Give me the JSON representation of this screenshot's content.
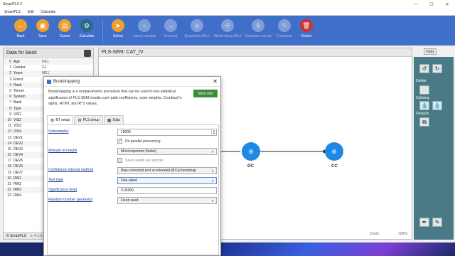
{
  "app": {
    "title": "SmartPLS 4",
    "menu": [
      "SmartPLS",
      "Edit",
      "Calculate"
    ],
    "window_controls": [
      "—",
      "☐",
      "✕"
    ]
  },
  "toolbar": {
    "items": [
      {
        "label": "Back",
        "icon": "back-arrow-icon",
        "color": "#f0a030",
        "glyph": "←",
        "dim": false
      },
      {
        "label": "Save",
        "icon": "save-icon",
        "color": "#f0a030",
        "glyph": "▣",
        "dim": false
      },
      {
        "label": "Comet",
        "icon": "document-icon",
        "color": "#f0a030",
        "glyph": "▤",
        "dim": false
      },
      {
        "label": "Calculate",
        "icon": "gear-icon",
        "color": "#2a6a8a",
        "glyph": "⚙",
        "dim": false
      },
      {
        "label": "Select",
        "icon": "cursor-icon",
        "color": "#f0a030",
        "glyph": "➤",
        "dim": false
      },
      {
        "label": "Latent variable",
        "icon": "latent-variable-icon",
        "color": "#f0a030",
        "glyph": "○",
        "dim": true
      },
      {
        "label": "Connect",
        "icon": "connect-icon",
        "color": "#f0a030",
        "glyph": "→",
        "dim": true
      },
      {
        "label": "Quadratic effect",
        "icon": "quadratic-icon",
        "color": "#f0a030",
        "glyph": "⊕",
        "dim": true
      },
      {
        "label": "Moderating effect",
        "icon": "moderating-icon",
        "color": "#f0a030",
        "glyph": "✣",
        "dim": true
      },
      {
        "label": "Gaussian copula",
        "icon": "copula-icon",
        "color": "#f0a030",
        "glyph": "✣",
        "dim": true
      },
      {
        "label": "Comment",
        "icon": "comment-icon",
        "color": "#f0a030",
        "glyph": "✎",
        "dim": true
      },
      {
        "label": "Delete",
        "icon": "trash-icon",
        "color": "#d03030",
        "glyph": "🗑",
        "dim": false
      }
    ]
  },
  "left_panel": {
    "title": "Data for Book",
    "rows": [
      {
        "n": "0",
        "name": "Age",
        "code": "NE1"
      },
      {
        "n": "1",
        "name": "Gender",
        "code": "G1"
      },
      {
        "n": "2",
        "name": "Years",
        "code": "ME1"
      },
      {
        "n": "3",
        "name": "Errect",
        "code": ""
      },
      {
        "n": "4",
        "name": "Rank",
        "code": ""
      },
      {
        "n": "5",
        "name": "Tenure",
        "code": ""
      },
      {
        "n": "6",
        "name": "System",
        "code": ""
      },
      {
        "n": "7",
        "name": "Bank",
        "code": ""
      },
      {
        "n": "8",
        "name": "Type",
        "code": ""
      },
      {
        "n": "9",
        "name": "VIS1",
        "code": ""
      },
      {
        "n": "10",
        "name": "VIS2",
        "code": ""
      },
      {
        "n": "11",
        "name": "VIS3",
        "code": ""
      },
      {
        "n": "12",
        "name": "VIS4",
        "code": ""
      },
      {
        "n": "13",
        "name": "DEV1",
        "code": ""
      },
      {
        "n": "14",
        "name": "DEV2",
        "code": ""
      },
      {
        "n": "15",
        "name": "DEV3",
        "code": ""
      },
      {
        "n": "16",
        "name": "DEV4",
        "code": ""
      },
      {
        "n": "17",
        "name": "DEV5",
        "code": ""
      },
      {
        "n": "18",
        "name": "DEV6",
        "code": ""
      },
      {
        "n": "19",
        "name": "DEV7",
        "code": ""
      },
      {
        "n": "20",
        "name": "RW1",
        "code": ""
      },
      {
        "n": "21",
        "name": "RW2",
        "code": ""
      },
      {
        "n": "22",
        "name": "RW3",
        "code": ""
      },
      {
        "n": "23",
        "name": "RW4",
        "code": ""
      }
    ],
    "footer_brand": "© SmartPLS",
    "footer_version": "v. 4.1.0.2"
  },
  "canvas": {
    "title": "PLS-SEM: CAT_IV",
    "nodes": [
      {
        "label": "OC"
      },
      {
        "label": "CC"
      }
    ],
    "zoom_label": "Zoom",
    "zoom_value": "100%"
  },
  "right_panel": {
    "tools_label": "Tools",
    "delete_label": "Delete",
    "coloring_label": "Coloring",
    "defaults_label": "Defaults"
  },
  "dialog": {
    "title": "Bootstrapping",
    "description": "Bootstrapping is a nonparametric procedure that can be used to test statistical significance of PLS-SEM results such path coefficients, outer weights, Cronbach's alpha, HTMT, and R^2 values.",
    "more_info": "More info",
    "tabs": [
      {
        "label": "BT setup",
        "icon": "gear-icon",
        "glyph": "⚙"
      },
      {
        "label": "PLS setup",
        "icon": "gear-icon",
        "glyph": "⚙"
      },
      {
        "label": "Data",
        "icon": "table-icon",
        "glyph": "▦"
      }
    ],
    "fields": {
      "subsamples_label": "Subsamples",
      "subsamples_value": "10000",
      "parallel_label": "Do parallel processing",
      "amount_label": "Amount of results",
      "amount_value": "Most important (faster)",
      "save_label": "Save results per sample",
      "ci_label": "Confidence interval method",
      "ci_value": "Bias-corrected and accelerated (BCa) bootstrap",
      "test_label": "Test type",
      "test_value": "One tailed",
      "sig_label": "Significance level",
      "sig_value": "0.05000",
      "rng_label": "Random number generator",
      "rng_value": "Fixed seed"
    }
  }
}
